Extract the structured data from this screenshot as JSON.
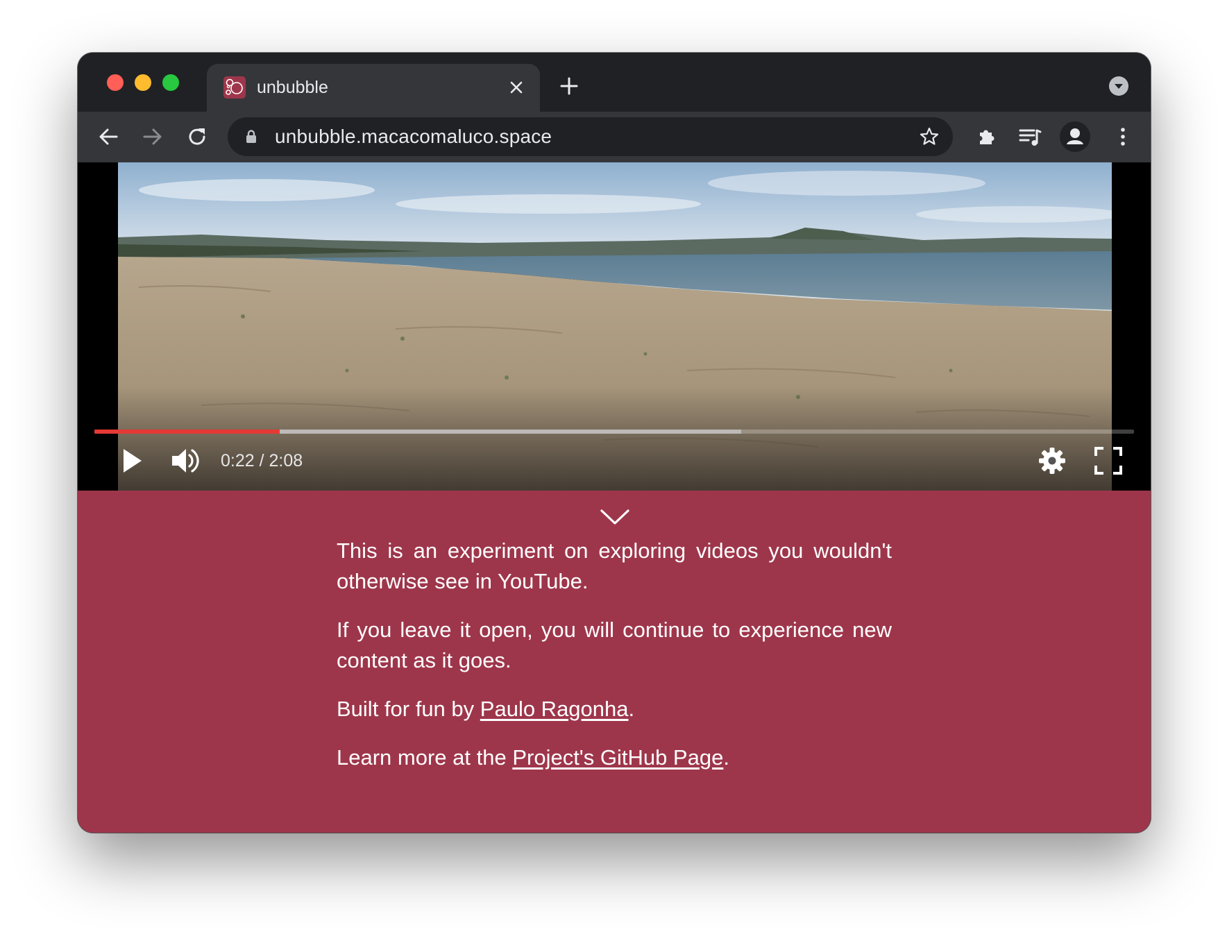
{
  "browser": {
    "tab": {
      "title": "unbubble",
      "favicon": "unbubble-logo-icon"
    },
    "toolbar": {
      "url": "unbubble.macacomaluco.space",
      "icons": [
        "back-arrow-icon",
        "forward-arrow-icon",
        "reload-icon",
        "lock-icon",
        "bookmark-star-icon",
        "extensions-puzzle-icon",
        "media-queue-icon",
        "profile-icon",
        "menu-kebab-icon"
      ]
    },
    "window_controls": [
      "close",
      "minimize",
      "maximize"
    ]
  },
  "player": {
    "current_time": "0:22",
    "duration": "2:08",
    "time_display": "0:22 / 2:08",
    "played_fraction": 0.178,
    "buffered_fraction": 0.622,
    "state": "paused",
    "controls": [
      "play-icon",
      "volume-icon",
      "settings-gear-icon",
      "fullscreen-icon"
    ],
    "progress_color": "#e53935"
  },
  "about": {
    "p1": "This is an experiment on exploring videos you wouldn't otherwise see in YouTube.",
    "p2": "If you leave it open, you will continue to experience new content as it goes.",
    "p3_prefix": "Built for fun by ",
    "p3_link": "Paulo Ragonha",
    "p3_suffix": ".",
    "p4_prefix": "Learn more at the ",
    "p4_link": "Project's GitHub Page",
    "p4_suffix": "."
  },
  "colors": {
    "page_background": "#9e364b",
    "browser_frame": "#202124",
    "toolbar": "#35363a"
  }
}
